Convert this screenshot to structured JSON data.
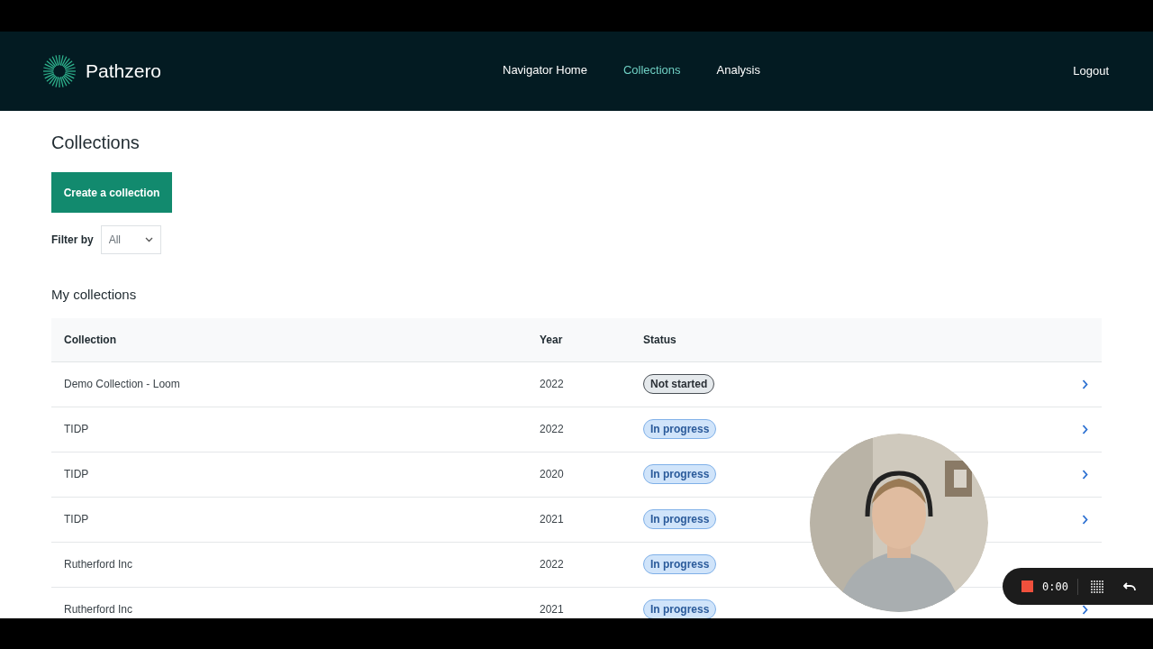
{
  "header": {
    "brand": "Pathzero",
    "nav": [
      {
        "label": "Navigator Home",
        "selected": false
      },
      {
        "label": "Collections",
        "selected": true
      },
      {
        "label": "Analysis",
        "selected": false
      }
    ],
    "logout": "Logout"
  },
  "page": {
    "title": "Collections",
    "create_button": "Create a collection",
    "filter": {
      "label": "Filter by",
      "value": "All"
    }
  },
  "table": {
    "title": "My collections",
    "columns": [
      "Collection",
      "Year",
      "Status"
    ],
    "rows": [
      {
        "collection": "Demo Collection - Loom",
        "year": "2022",
        "status": "Not started",
        "kind": "not_started",
        "arrow": true
      },
      {
        "collection": "TIDP",
        "year": "2022",
        "status": "In progress",
        "kind": "in_progress",
        "arrow": true
      },
      {
        "collection": "TIDP",
        "year": "2020",
        "status": "In progress",
        "kind": "in_progress",
        "arrow": true
      },
      {
        "collection": "TIDP",
        "year": "2021",
        "status": "In progress",
        "kind": "in_progress",
        "arrow": true
      },
      {
        "collection": "Rutherford Inc",
        "year": "2022",
        "status": "In progress",
        "kind": "in_progress",
        "arrow": false
      },
      {
        "collection": "Rutherford Inc",
        "year": "2021",
        "status": "In progress",
        "kind": "in_progress",
        "arrow": true
      }
    ]
  },
  "recorder": {
    "time": "0:00"
  }
}
